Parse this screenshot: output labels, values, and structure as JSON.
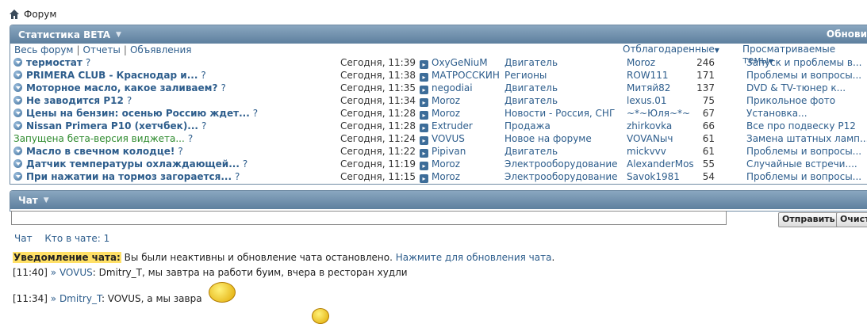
{
  "breadcrumb": {
    "label": "Форум"
  },
  "stats": {
    "title": "Статистика BETA",
    "refresh_label": "Обнови",
    "tabs": [
      "Весь форум",
      "Отчеты",
      "Объявления"
    ],
    "col_thanked": "Отблагодаренные",
    "col_viewed": "Просматриваемые темы",
    "rows": [
      {
        "title": "термостат",
        "time": "Сегодня, 11:39",
        "user": "OxyGeNiuM",
        "forum": "Двигатель",
        "thanked_user": "Moroz",
        "count": "246",
        "viewed": "Запуск и проблемы в..."
      },
      {
        "title": "PRIMERA CLUB - Краснодар и...",
        "time": "Сегодня, 11:38",
        "user": "МАТРОССКИН",
        "forum": "Регионы",
        "thanked_user": "ROW111",
        "count": "171",
        "viewed": "Проблемы и вопросы..."
      },
      {
        "title": "Моторное масло, какое заливаем?",
        "time": "Сегодня, 11:35",
        "user": "negodiai",
        "forum": "Двигатель",
        "thanked_user": "Митяй82",
        "count": "137",
        "viewed": "DVD & TV-тюнер к..."
      },
      {
        "title": "Не заводится Р12",
        "time": "Сегодня, 11:34",
        "user": "Moroz",
        "forum": "Двигатель",
        "thanked_user": "lexus.01",
        "count": "75",
        "viewed": "Прикольное фото"
      },
      {
        "title": "Цены на бензин: осенью Россию ждет...",
        "time": "Сегодня, 11:28",
        "user": "Moroz",
        "forum": "Новости - Россия, СНГ",
        "thanked_user": "~*~Юля~*~",
        "count": "67",
        "viewed": "Установка..."
      },
      {
        "title": "Nissan Primera P10 (хетчбек)...",
        "time": "Сегодня, 11:28",
        "user": "Extruder",
        "forum": "Продажа",
        "thanked_user": "zhirkovka",
        "count": "66",
        "viewed": "Все про подвеску Р12"
      },
      {
        "title": "Запущена бета-версия виджета...",
        "time": "Сегодня, 11:24",
        "user": "VOVUS",
        "forum": "Новое на форуме",
        "thanked_user": "VOVANыч",
        "count": "61",
        "viewed": "Замена штатных ламп...",
        "green": true
      },
      {
        "title": "Масло в свечном колодце!",
        "time": "Сегодня, 11:22",
        "user": "Pipivan",
        "forum": "Двигатель",
        "thanked_user": "mickvvv",
        "count": "61",
        "viewed": "Проблемы и вопросы..."
      },
      {
        "title": "Датчик температуры охлаждающей...",
        "time": "Сегодня, 11:19",
        "user": "Moroz",
        "forum": "Электрооборудование",
        "thanked_user": "AlexanderMos",
        "count": "55",
        "viewed": "Случайные встречи...."
      },
      {
        "title": "При нажатии на тормоз загорается...",
        "time": "Сегодня, 11:15",
        "user": "Moroz",
        "forum": "Электрооборудование",
        "thanked_user": "Savok1981",
        "count": "54",
        "viewed": "Проблемы и вопросы..."
      }
    ]
  },
  "chat": {
    "title": "Чат",
    "send_label": "Отправить",
    "clear_label": "Очисти",
    "tab_chat": "Чат",
    "tab_who": "Кто в чате: 1",
    "notice_label": "Уведомление чата:",
    "notice_text": " Вы были неактивны и обновление чата остановлено. ",
    "notice_link": "Нажмите для обновления чата",
    "notice_end": ".",
    "messages": [
      {
        "time": "[11:40]",
        "user": "» VOVUS",
        "text": ": Dmitry_T, мы завтра на работи буим, вчера в ресторан худли"
      },
      {
        "time": "[11:34]",
        "user": "» Dmitry_T",
        "text": ": VOVUS, а мы завра"
      }
    ]
  }
}
